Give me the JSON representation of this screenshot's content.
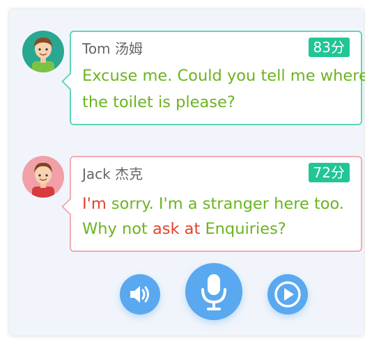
{
  "dialogue": [
    {
      "speaker": "Tom 汤姆",
      "score": "83分",
      "lines": [
        [
          {
            "text": "Excuse me. Could you tell me where",
            "status": "good"
          }
        ],
        [
          {
            "text": "the toilet is please?",
            "status": "good"
          }
        ]
      ],
      "avatar_icon": "boy-avatar-icon"
    },
    {
      "speaker": "Jack 杰克",
      "score": "72分",
      "lines": [
        [
          {
            "text": "I'm",
            "status": "bad"
          },
          {
            "text": " sorry. I'm a stranger here too.",
            "status": "good"
          }
        ],
        [
          {
            "text": "Why not ",
            "status": "good"
          },
          {
            "text": "ask at",
            "status": "bad"
          },
          {
            "text": " Enquiries?",
            "status": "good"
          }
        ]
      ],
      "avatar_icon": "boy-avatar-icon"
    }
  ],
  "controls": [
    {
      "name": "speaker-icon"
    },
    {
      "name": "microphone-icon"
    },
    {
      "name": "play-icon"
    }
  ],
  "colors": {
    "good_text": "#6bb41f",
    "bad_text": "#e0442c",
    "tom_border": "#5fd5b8",
    "jack_border": "#f2a9b5",
    "score_bg": "#22c596",
    "button_blue": "#5aa8f0"
  }
}
